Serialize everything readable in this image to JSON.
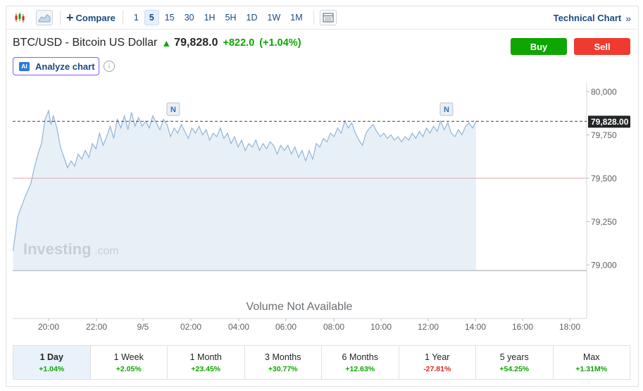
{
  "toolbar": {
    "compare_label": "Compare",
    "intervals": [
      "1",
      "5",
      "15",
      "30",
      "1H",
      "5H",
      "1D",
      "1W",
      "1M"
    ],
    "active_interval": "5",
    "technical_chart_label": "Technical Chart",
    "technical_chart_chevron": "»"
  },
  "instrument": {
    "name": "BTC/USD - Bitcoin US Dollar",
    "price": "79,828.0",
    "change": "+822.0",
    "change_pct": "(+1.04%)"
  },
  "actions": {
    "buy_label": "Buy",
    "sell_label": "Sell"
  },
  "ai": {
    "badge": "AI",
    "label": "Analyze chart",
    "info_icon": "i"
  },
  "chart_data": {
    "type": "area",
    "y_ticks": [
      "80,000",
      "79,750",
      "79,500",
      "79,250",
      "79,000"
    ],
    "x_ticks": [
      "20:00",
      "22:00",
      "9/5",
      "02:00",
      "04:00",
      "06:00",
      "08:00",
      "10:00",
      "12:00",
      "14:00",
      "16:00",
      "18:00"
    ],
    "ylim": [
      79000,
      80000
    ],
    "current_price_label": "79,828.00",
    "current_price": 79828,
    "reference_price": 79500,
    "news_markers": [
      "N",
      "N"
    ],
    "watermark_brand": "Investing",
    "watermark_suffix": ".com",
    "volume_note": "Volume Not Available",
    "series_points": [
      [
        18.5,
        79080
      ],
      [
        18.7,
        79280
      ],
      [
        19.0,
        79390
      ],
      [
        19.25,
        79470
      ],
      [
        19.4,
        79560
      ],
      [
        19.55,
        79640
      ],
      [
        19.7,
        79700
      ],
      [
        19.85,
        79840
      ],
      [
        20.0,
        79890
      ],
      [
        20.1,
        79810
      ],
      [
        20.2,
        79860
      ],
      [
        20.35,
        79790
      ],
      [
        20.5,
        79680
      ],
      [
        20.65,
        79620
      ],
      [
        20.8,
        79560
      ],
      [
        20.95,
        79600
      ],
      [
        21.1,
        79570
      ],
      [
        21.25,
        79640
      ],
      [
        21.4,
        79610
      ],
      [
        21.55,
        79660
      ],
      [
        21.7,
        79620
      ],
      [
        21.85,
        79700
      ],
      [
        22.0,
        79670
      ],
      [
        22.15,
        79760
      ],
      [
        22.3,
        79690
      ],
      [
        22.45,
        79740
      ],
      [
        22.6,
        79800
      ],
      [
        22.75,
        79730
      ],
      [
        22.9,
        79840
      ],
      [
        23.05,
        79790
      ],
      [
        23.2,
        79860
      ],
      [
        23.35,
        79780
      ],
      [
        23.5,
        79880
      ],
      [
        23.65,
        79800
      ],
      [
        23.8,
        79850
      ],
      [
        23.95,
        79800
      ],
      [
        24.1,
        79830
      ],
      [
        24.25,
        79790
      ],
      [
        24.4,
        79860
      ],
      [
        24.55,
        79820
      ],
      [
        24.7,
        79780
      ],
      [
        24.85,
        79840
      ],
      [
        25.0,
        79810
      ],
      [
        25.15,
        79740
      ],
      [
        25.3,
        79790
      ],
      [
        25.45,
        79760
      ],
      [
        25.6,
        79810
      ],
      [
        25.75,
        79770
      ],
      [
        25.9,
        79730
      ],
      [
        26.05,
        79790
      ],
      [
        26.2,
        79760
      ],
      [
        26.35,
        79800
      ],
      [
        26.5,
        79750
      ],
      [
        26.65,
        79780
      ],
      [
        26.8,
        79720
      ],
      [
        26.95,
        79760
      ],
      [
        27.1,
        79740
      ],
      [
        27.25,
        79790
      ],
      [
        27.4,
        79730
      ],
      [
        27.55,
        79760
      ],
      [
        27.7,
        79700
      ],
      [
        27.85,
        79740
      ],
      [
        28.0,
        79680
      ],
      [
        28.15,
        79720
      ],
      [
        28.3,
        79660
      ],
      [
        28.45,
        79700
      ],
      [
        28.6,
        79680
      ],
      [
        28.75,
        79720
      ],
      [
        28.9,
        79660
      ],
      [
        29.05,
        79700
      ],
      [
        29.2,
        79670
      ],
      [
        29.35,
        79710
      ],
      [
        29.5,
        79690
      ],
      [
        29.65,
        79640
      ],
      [
        29.8,
        79690
      ],
      [
        29.95,
        79660
      ],
      [
        30.1,
        79690
      ],
      [
        30.25,
        79640
      ],
      [
        30.4,
        79680
      ],
      [
        30.55,
        79620
      ],
      [
        30.7,
        79660
      ],
      [
        30.85,
        79600
      ],
      [
        31.0,
        79660
      ],
      [
        31.15,
        79610
      ],
      [
        31.3,
        79700
      ],
      [
        31.45,
        79680
      ],
      [
        31.6,
        79730
      ],
      [
        31.75,
        79710
      ],
      [
        31.9,
        79760
      ],
      [
        32.05,
        79740
      ],
      [
        32.2,
        79790
      ],
      [
        32.35,
        79760
      ],
      [
        32.5,
        79830
      ],
      [
        32.65,
        79790
      ],
      [
        32.8,
        79820
      ],
      [
        32.95,
        79760
      ],
      [
        33.1,
        79720
      ],
      [
        33.25,
        79690
      ],
      [
        33.4,
        79760
      ],
      [
        33.55,
        79790
      ],
      [
        33.7,
        79810
      ],
      [
        33.85,
        79770
      ],
      [
        34.0,
        79740
      ],
      [
        34.15,
        79760
      ],
      [
        34.3,
        79730
      ],
      [
        34.45,
        79750
      ],
      [
        34.6,
        79720
      ],
      [
        34.75,
        79740
      ],
      [
        34.9,
        79710
      ],
      [
        35.05,
        79740
      ],
      [
        35.2,
        79720
      ],
      [
        35.35,
        79760
      ],
      [
        35.5,
        79730
      ],
      [
        35.65,
        79770
      ],
      [
        35.8,
        79740
      ],
      [
        35.95,
        79790
      ],
      [
        36.1,
        79760
      ],
      [
        36.25,
        79800
      ],
      [
        36.4,
        79770
      ],
      [
        36.55,
        79830
      ],
      [
        36.7,
        79780
      ],
      [
        36.85,
        79820
      ],
      [
        37.0,
        79760
      ],
      [
        37.15,
        79740
      ],
      [
        37.3,
        79780
      ],
      [
        37.45,
        79750
      ],
      [
        37.6,
        79800
      ],
      [
        37.75,
        79820
      ],
      [
        37.9,
        79790
      ],
      [
        38.05,
        79828
      ]
    ]
  },
  "periods": [
    {
      "label": "1 Day",
      "pct": "+1.04%",
      "sign": "pos",
      "active": true
    },
    {
      "label": "1 Week",
      "pct": "+2.05%",
      "sign": "pos",
      "active": false
    },
    {
      "label": "1 Month",
      "pct": "+23.45%",
      "sign": "pos",
      "active": false
    },
    {
      "label": "3 Months",
      "pct": "+30.77%",
      "sign": "pos",
      "active": false
    },
    {
      "label": "6 Months",
      "pct": "+12.63%",
      "sign": "pos",
      "active": false
    },
    {
      "label": "1 Year",
      "pct": "-27.81%",
      "sign": "neg",
      "active": false
    },
    {
      "label": "5 years",
      "pct": "+54.25%",
      "sign": "pos",
      "active": false
    },
    {
      "label": "Max",
      "pct": "+1.31M%",
      "sign": "pos",
      "active": false
    }
  ],
  "colors": {
    "line": "#8fb5d9",
    "area": "#e6eef6",
    "up": "#0ea600",
    "down": "#e0281f",
    "link": "#1a4a80",
    "buy": "#0ea600",
    "sell": "#f03a2f"
  }
}
